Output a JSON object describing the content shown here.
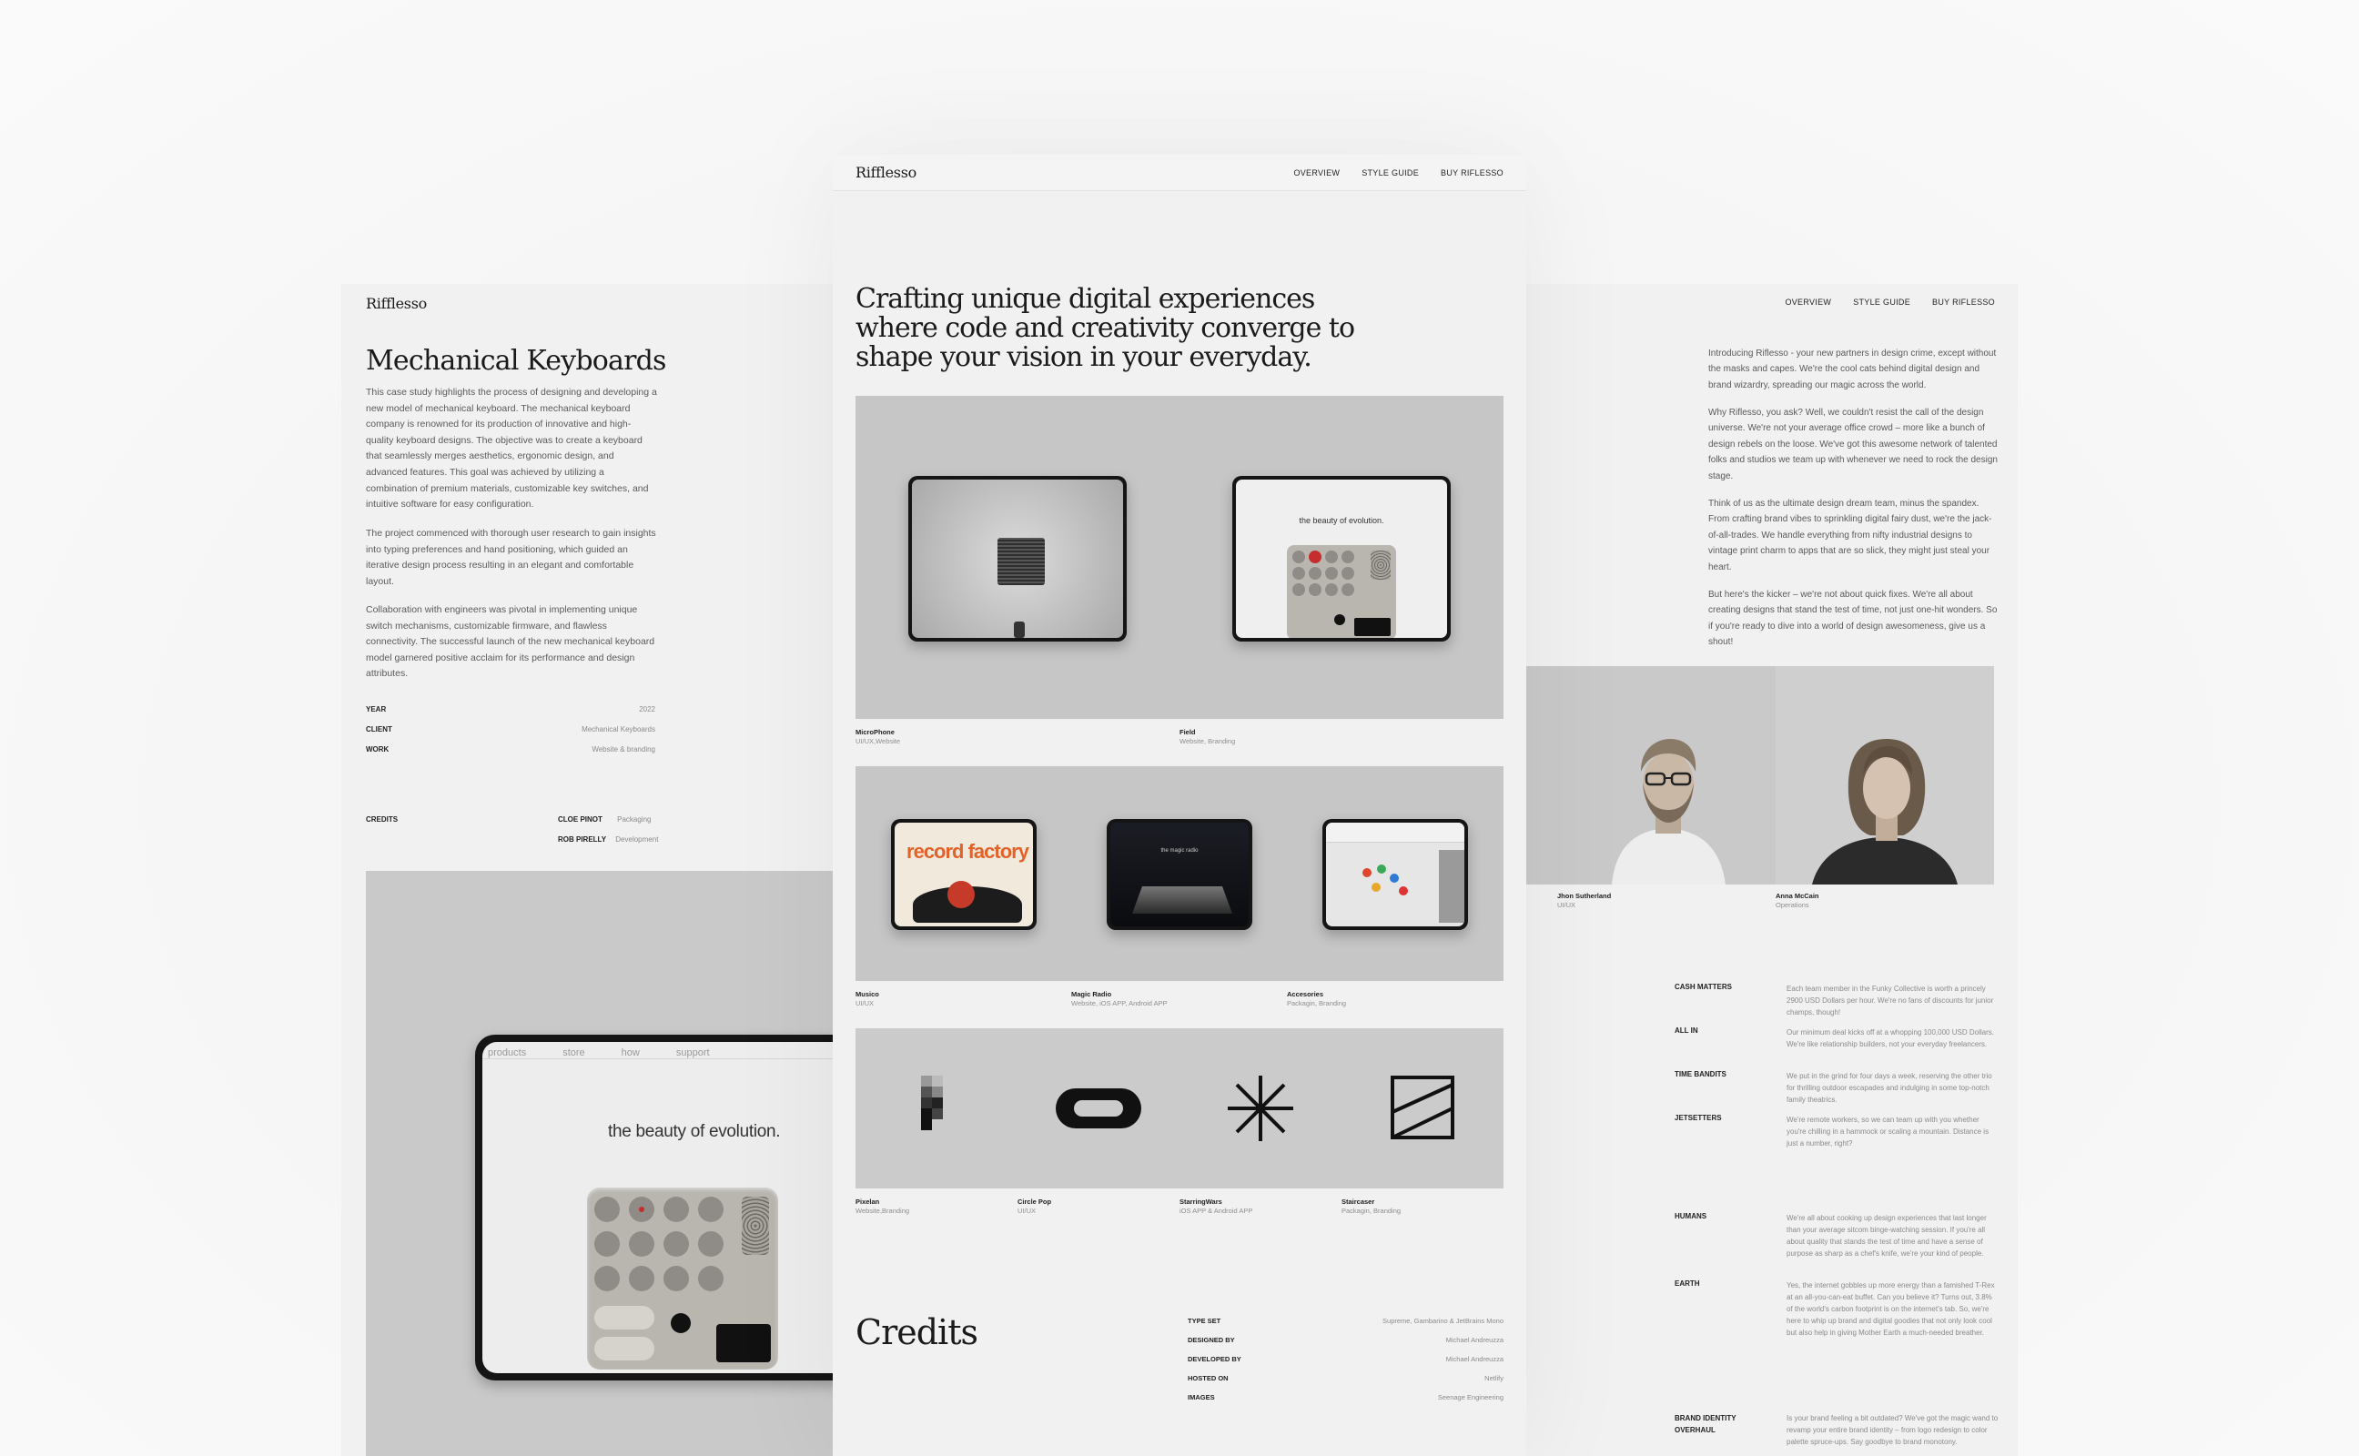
{
  "left": {
    "brand": "Rifflesso",
    "title": "Mechanical Keyboards",
    "paragraphs": [
      "This case study highlights the process of designing and developing a new model of mechanical keyboard. The mechanical keyboard company is renowned for its production of innovative and high-quality keyboard designs. The objective was to create a keyboard that seamlessly merges aesthetics, ergonomic design, and advanced features. This goal was achieved by utilizing a combination of premium materials, customizable key switches, and intuitive software for easy configuration.",
      "The project commenced with thorough user research to gain insights into typing preferences and hand positioning, which guided an iterative design process resulting in an elegant and comfortable layout.",
      "Collaboration with engineers was pivotal in implementing unique switch mechanisms, customizable firmware, and flawless connectivity. The successful launch of the new mechanical keyboard model garnered positive acclaim for its performance and design attributes."
    ],
    "meta": [
      {
        "key": "YEAR",
        "value": "2022"
      },
      {
        "key": "CLIENT",
        "value": "Mechanical Keyboards"
      },
      {
        "key": "WORK",
        "value": "Website & branding"
      }
    ],
    "credits_label": "CREDITS",
    "credits": [
      {
        "name": "CLOE PINOT",
        "role": "Packaging"
      },
      {
        "name": "ROB PIRELLY",
        "role": "Development"
      }
    ],
    "hero_text": "the beauty of evolution.",
    "hero_menu": [
      "products",
      "store",
      "how",
      "support"
    ]
  },
  "center": {
    "brand": "Rifflesso",
    "nav": [
      "OVERVIEW",
      "STYLE GUIDE",
      "BUY RIFLESSO"
    ],
    "headline": "Crafting unique digital experiences where code and creativity converge to shape your vision in your everyday.",
    "row1": [
      {
        "title": "MicroPhone",
        "sub": "UI/UX,Website"
      },
      {
        "title": "Field",
        "sub": "Website, Branding",
        "screen_text": "the beauty of evolution."
      }
    ],
    "row2": [
      {
        "title": "Musico",
        "sub": "UI/UX",
        "screen_text": "record factory"
      },
      {
        "title": "Magic Radio",
        "sub": "Website, iOS APP, Android APP",
        "screen_text": "the magic radio"
      },
      {
        "title": "Accesories",
        "sub": "Packagin, Branding"
      }
    ],
    "row3": [
      {
        "title": "Pixelan",
        "sub": "Website,Branding"
      },
      {
        "title": "Circle Pop",
        "sub": "UI/UX"
      },
      {
        "title": "StarringWars",
        "sub": "iOS APP & Android APP"
      },
      {
        "title": "Staircaser",
        "sub": "Packagin, Branding"
      }
    ],
    "credits_title": "Credits",
    "credits": [
      {
        "key": "TYPE SET",
        "value": "Supreme, Gambarino & JetBrains Mono"
      },
      {
        "key": "DESIGNED BY",
        "value": "Michael Andreuzza"
      },
      {
        "key": "DEVELOPED BY",
        "value": "Michael Andreuzza"
      },
      {
        "key": "HOSTED ON",
        "value": "Netlify"
      },
      {
        "key": "IMAGES",
        "value": "Seenage Engineering"
      }
    ]
  },
  "right": {
    "nav": [
      "OVERVIEW",
      "STYLE GUIDE",
      "BUY RIFLESSO"
    ],
    "paragraphs": [
      "Introducing Riflesso - your new partners in design crime, except without the masks and capes. We're the cool cats behind digital design and brand wizardry, spreading our magic across the world.",
      "Why Riflesso, you ask? Well, we couldn't resist the call of the design universe. We're not your average office crowd – more like a bunch of design rebels on the loose. We've got this awesome network of talented folks and studios we team up with whenever we need to rock the design stage.",
      "Think of us as the ultimate design dream team, minus the spandex. From crafting brand vibes to sprinkling digital fairy dust, we're the jack-of-all-trades. We handle everything from nifty industrial designs to vintage print charm to apps that are so slick, they might just steal your heart.",
      "But here's the kicker – we're not about quick fixes. We're all about creating designs that stand the test of time, not just one-hit wonders. So if you're ready to dive into a world of design awesomeness, give us a shout!"
    ],
    "team": [
      {
        "name": "Jhon Sutherland",
        "role": "UI/UX"
      },
      {
        "name": "Anna McCain",
        "role": "Operations"
      }
    ],
    "values": [
      {
        "key": "CASH MATTERS",
        "text": "Each team member in the Funky Collective is worth a princely 2900 USD Dollars per hour. We're no fans of discounts for junior champs, though!"
      },
      {
        "key": "ALL IN",
        "text": "Our minimum deal kicks off at a whopping 100,000 USD Dollars. We're like relationship builders, not your everyday freelancers."
      },
      {
        "key": "TIME BANDITS",
        "text": "We put in the grind for four days a week, reserving the other trio for thrilling outdoor escapades and indulging in some top-notch family theatrics."
      },
      {
        "key": "JETSETTERS",
        "text": "We're remote workers, so we can team up with you whether you're chilling in a hammock or scaling a mountain. Distance is just a number, right?"
      },
      {
        "key": "HUMANS",
        "text": "We're all about cooking up design experiences that last longer than your average sitcom binge-watching session. If you're all about quality that stands the test of time and have a sense of purpose as sharp as a chef's knife, we're your kind of people."
      },
      {
        "key": "EARTH",
        "text": "Yes, the internet gobbles up more energy than a famished T-Rex at an all-you-can-eat buffet. Can you believe it? Turns out, 3.8% of the world's carbon footprint is on the internet's tab. So, we're here to whip up brand and digital goodies that not only look cool but also help in giving Mother Earth a much-needed breather."
      },
      {
        "key": "BRAND IDENTITY OVERHAUL",
        "text": "Is your brand feeling a bit outdated? We've got the magic wand to revamp your entire brand identity – from logo redesign to color palette spruce-ups. Say goodbye to brand monotony."
      }
    ]
  }
}
